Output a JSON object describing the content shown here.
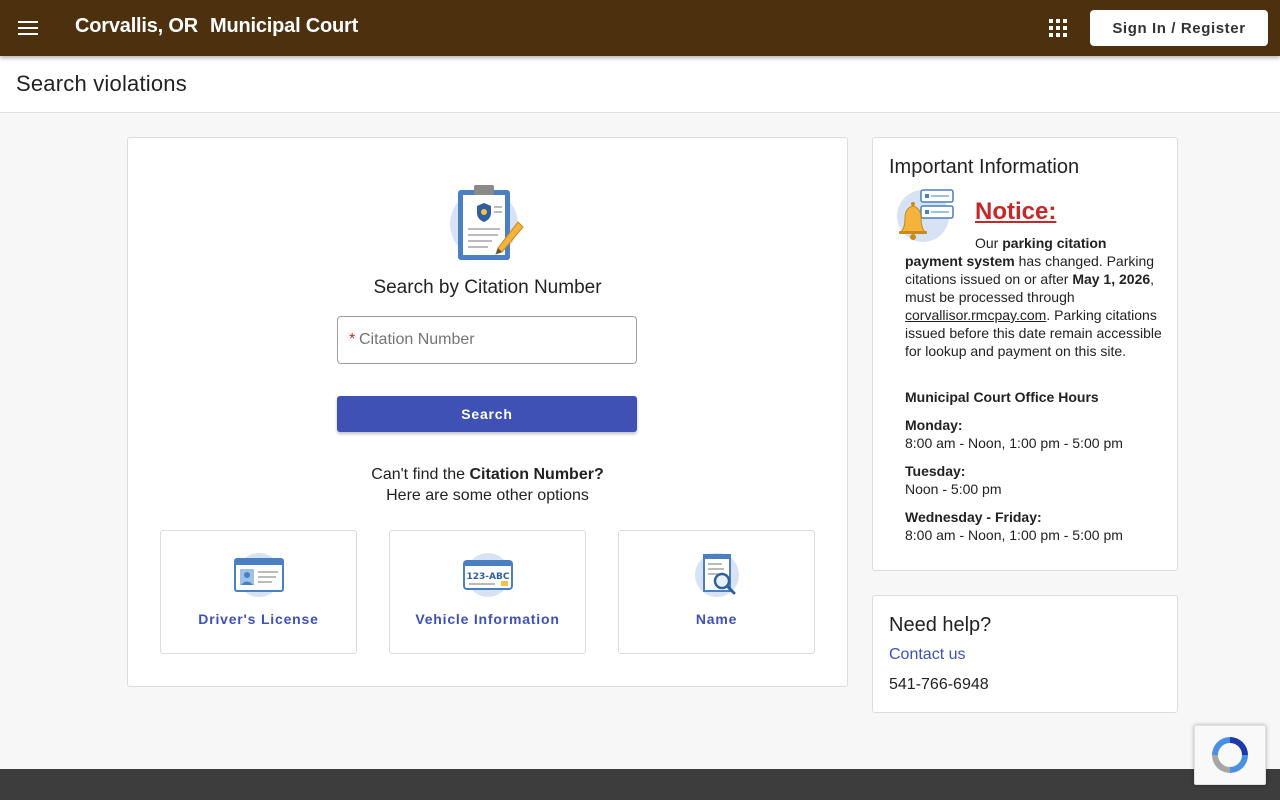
{
  "header": {
    "city": "Corvallis, OR",
    "court": "Municipal Court",
    "signin_label": "Sign In / Register",
    "background_color": "#4d300e",
    "menu_icon": "menu-icon",
    "apps_icon": "apps-grid-icon"
  },
  "page": {
    "title": "Search violations"
  },
  "search": {
    "heading": "Search by Citation Number",
    "required_mark": "*",
    "placeholder": "Citation Number",
    "button_label": "Search",
    "button_color": "#3f51b5",
    "cant_find_prefix": "Can't find the ",
    "cant_find_bold": "Citation Number?",
    "other_options": "Here are some other options",
    "icon": "clipboard-badge-icon"
  },
  "options": [
    {
      "label": "Driver's License",
      "icon": "id-card-icon"
    },
    {
      "label": "Vehicle Information",
      "icon": "license-plate-icon",
      "plate_text": "123-ABC"
    },
    {
      "label": "Name",
      "icon": "document-search-icon"
    }
  ],
  "info": {
    "title": "Important Information",
    "notice_heading": "Notice:",
    "notice_color": "#c62828",
    "notice_parts": {
      "p1": "Our ",
      "b1": "parking citation payment system",
      "p2": " has changed. Parking citations issued on or after ",
      "b2": "May 1, 2026",
      "p3": ", must be processed through ",
      "link": "corvallisor.rmcpay.com",
      "p4": ". Parking citations issued before this date remain accessible for lookup and payment on this site."
    },
    "hours_title": "Municipal Court Office Hours",
    "hours": [
      {
        "day": "Monday:",
        "time": "8:00 am - Noon, 1:00 pm - 5:00 pm"
      },
      {
        "day": "Tuesday:",
        "time": "Noon - 5:00 pm"
      },
      {
        "day": "Wednesday - Friday:",
        "time": "8:00 am - Noon, 1:00 pm - 5:00 pm"
      }
    ],
    "icon": "bell-notification-icon"
  },
  "help": {
    "title": "Need help?",
    "contact_label": "Contact us",
    "phone": "541-766-6948"
  }
}
